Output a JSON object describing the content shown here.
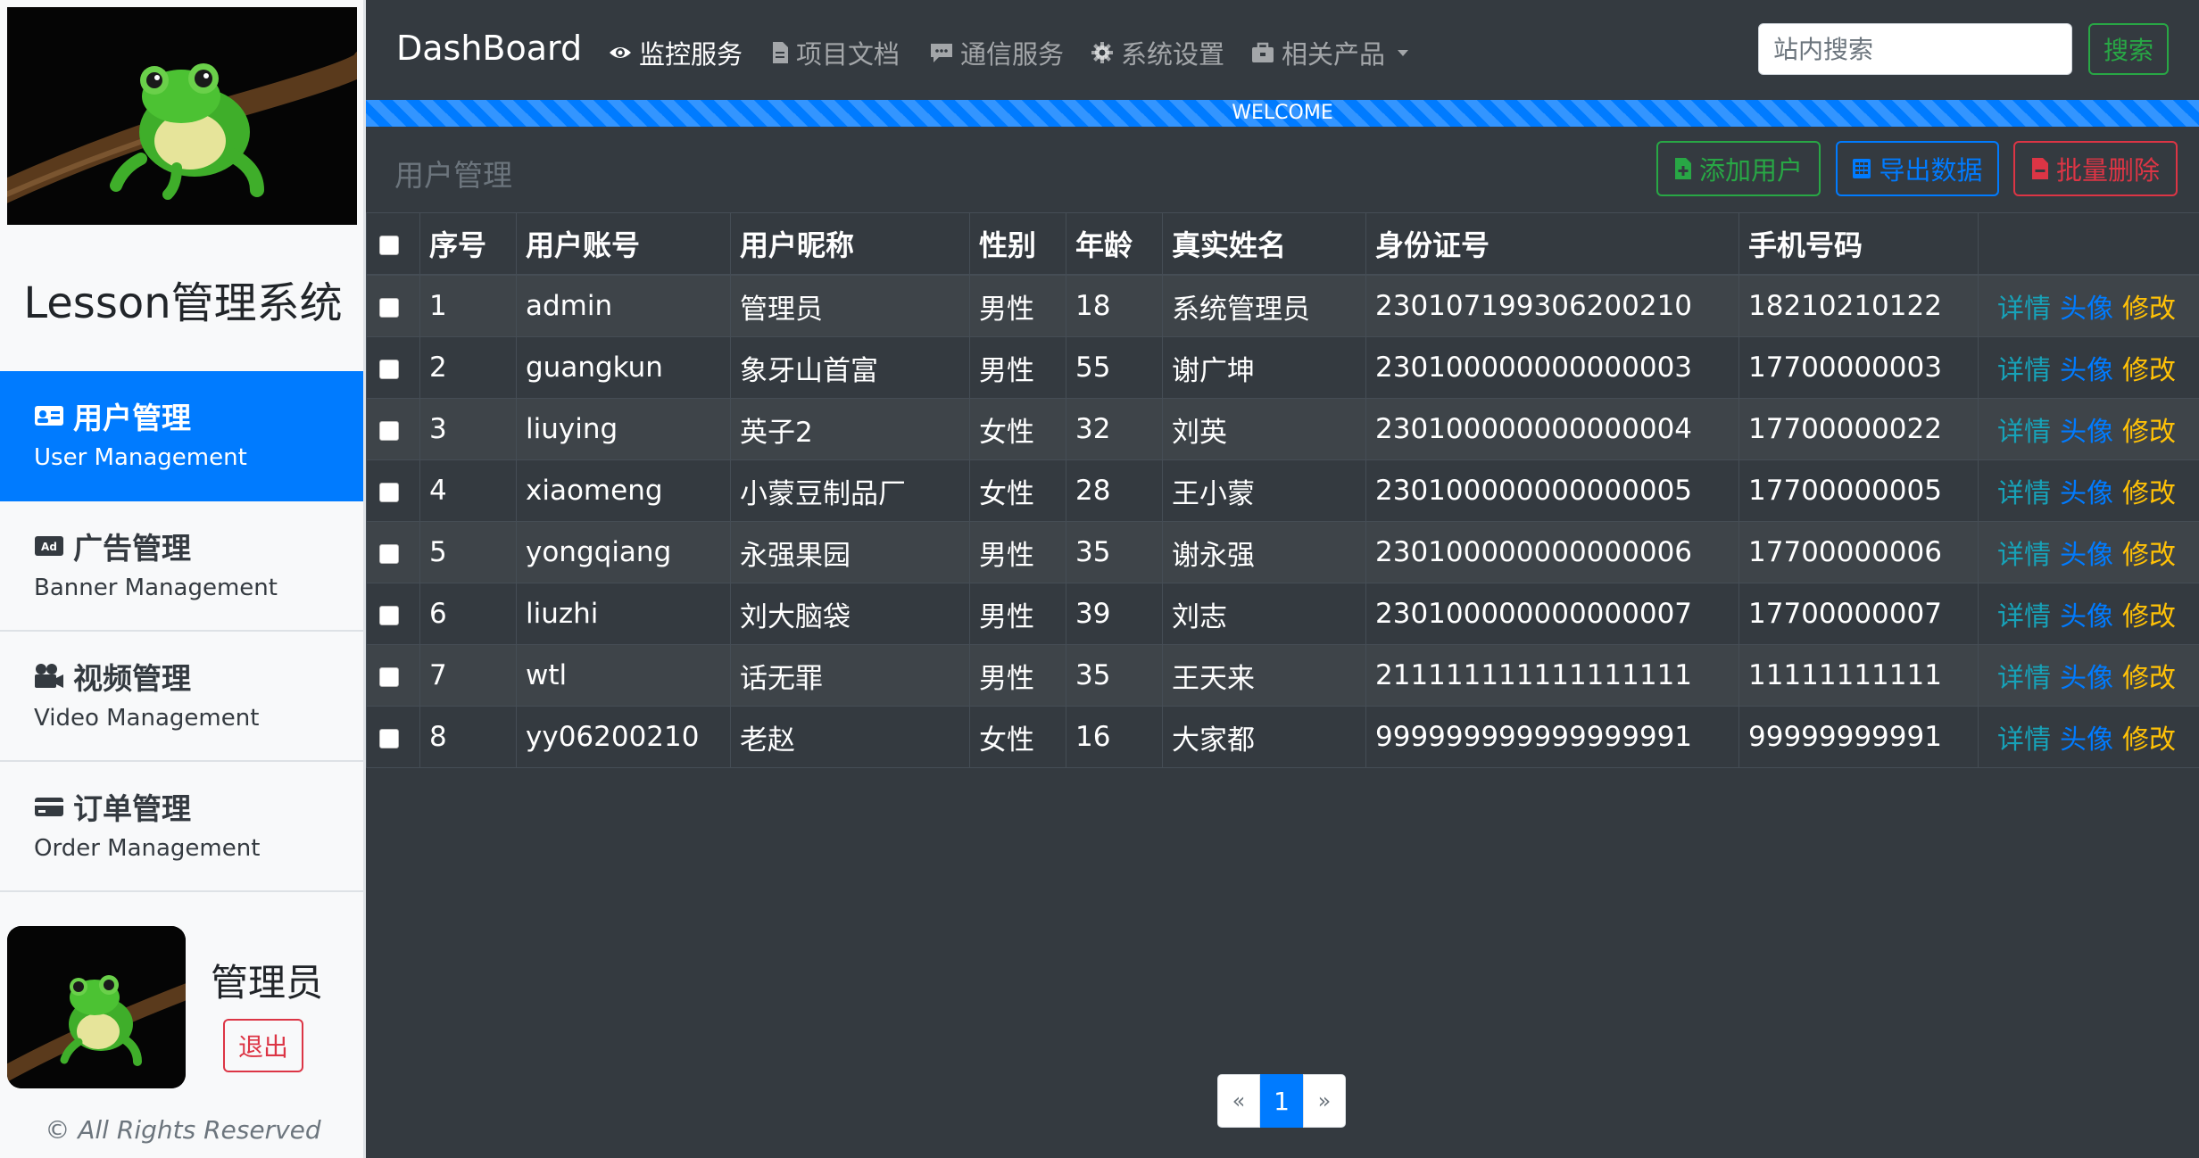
{
  "app": {
    "title": "Lesson管理系统"
  },
  "sidebar": {
    "items": [
      {
        "label": "用户管理",
        "sub": "User Management",
        "icon": "id-card-icon",
        "active": true
      },
      {
        "label": "广告管理",
        "sub": "Banner Management",
        "icon": "ad-icon",
        "active": false
      },
      {
        "label": "视频管理",
        "sub": "Video Management",
        "icon": "video-icon",
        "active": false
      },
      {
        "label": "订单管理",
        "sub": "Order Management",
        "icon": "credit-card-icon",
        "active": false
      }
    ],
    "user": {
      "name": "管理员",
      "logout_label": "退出"
    },
    "footer": "© All Rights Reserved"
  },
  "navbar": {
    "brand": "DashBoard",
    "menu": [
      {
        "label": "监控服务",
        "icon": "eye-icon",
        "active": true
      },
      {
        "label": "项目文档",
        "icon": "file-icon",
        "active": false
      },
      {
        "label": "通信服务",
        "icon": "comment-icon",
        "active": false
      },
      {
        "label": "系统设置",
        "icon": "gear-icon",
        "active": false
      },
      {
        "label": "相关产品",
        "icon": "briefcase-icon",
        "active": false
      }
    ],
    "search": {
      "placeholder": "站内搜索",
      "button_label": "搜索"
    }
  },
  "welcome_bar": {
    "label": "WELCOME",
    "progress": 1.0
  },
  "content": {
    "section_title": "用户管理",
    "actions": {
      "add": "添加用户",
      "export": "导出数据",
      "delete": "批量删除"
    }
  },
  "table": {
    "columns": [
      "序号",
      "用户账号",
      "用户昵称",
      "性别",
      "年龄",
      "真实姓名",
      "身份证号",
      "手机号码",
      ""
    ],
    "row_actions": {
      "detail": "详情",
      "avatar": "头像",
      "edit": "修改"
    },
    "rows": [
      {
        "no": "1",
        "account": "admin",
        "nickname": "管理员",
        "gender": "男性",
        "age": "18",
        "real_name": "系统管理员",
        "id_card": "230107199306200210",
        "phone": "18210210122"
      },
      {
        "no": "2",
        "account": "guangkun",
        "nickname": "象牙山首富",
        "gender": "男性",
        "age": "55",
        "real_name": "谢广坤",
        "id_card": "230100000000000003",
        "phone": "17700000003"
      },
      {
        "no": "3",
        "account": "liuying",
        "nickname": "英子2",
        "gender": "女性",
        "age": "32",
        "real_name": "刘英",
        "id_card": "230100000000000004",
        "phone": "17700000022"
      },
      {
        "no": "4",
        "account": "xiaomeng",
        "nickname": "小蒙豆制品厂",
        "gender": "女性",
        "age": "28",
        "real_name": "王小蒙",
        "id_card": "230100000000000005",
        "phone": "17700000005"
      },
      {
        "no": "5",
        "account": "yongqiang",
        "nickname": "永强果园",
        "gender": "男性",
        "age": "35",
        "real_name": "谢永强",
        "id_card": "230100000000000006",
        "phone": "17700000006"
      },
      {
        "no": "6",
        "account": "liuzhi",
        "nickname": "刘大脑袋",
        "gender": "男性",
        "age": "39",
        "real_name": "刘志",
        "id_card": "230100000000000007",
        "phone": "17700000007"
      },
      {
        "no": "7",
        "account": "wtl",
        "nickname": "话无罪",
        "gender": "男性",
        "age": "35",
        "real_name": "王天来",
        "id_card": "211111111111111111",
        "phone": "11111111111"
      },
      {
        "no": "8",
        "account": "yy06200210",
        "nickname": "老赵",
        "gender": "女性",
        "age": "16",
        "real_name": "大家都",
        "id_card": "999999999999999991",
        "phone": "99999999991"
      }
    ]
  },
  "pagination": {
    "prev": "«",
    "current": "1",
    "next": "»"
  }
}
